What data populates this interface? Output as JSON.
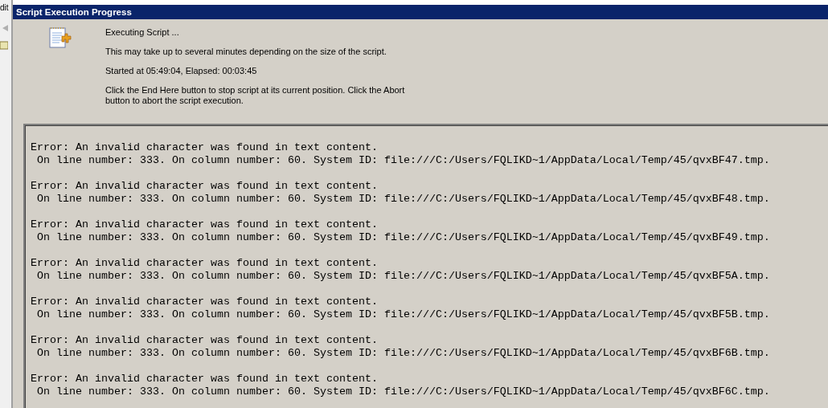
{
  "background_app": {
    "menu_text": "dit"
  },
  "dialog": {
    "title": "Script Execution Progress",
    "status": "Executing Script ...",
    "note": "This may take up to several minutes depending on the size of the script.",
    "timing": "Started at 05:49:04, Elapsed: 00:03:45",
    "instructions": "Click the End Here button to stop script at its current position. Click the Abort button to abort the script execution."
  },
  "log": [
    {
      "error": "Error: An invalid character was found in text content.",
      "detail": " On line number: 333. On column number: 60. System ID: file:///C:/Users/FQLIKD~1/AppData/Local/Temp/45/qvxBF47.tmp."
    },
    {
      "error": "Error: An invalid character was found in text content.",
      "detail": " On line number: 333. On column number: 60. System ID: file:///C:/Users/FQLIKD~1/AppData/Local/Temp/45/qvxBF48.tmp."
    },
    {
      "error": "Error: An invalid character was found in text content.",
      "detail": " On line number: 333. On column number: 60. System ID: file:///C:/Users/FQLIKD~1/AppData/Local/Temp/45/qvxBF49.tmp."
    },
    {
      "error": "Error: An invalid character was found in text content.",
      "detail": " On line number: 333. On column number: 60. System ID: file:///C:/Users/FQLIKD~1/AppData/Local/Temp/45/qvxBF5A.tmp."
    },
    {
      "error": "Error: An invalid character was found in text content.",
      "detail": " On line number: 333. On column number: 60. System ID: file:///C:/Users/FQLIKD~1/AppData/Local/Temp/45/qvxBF5B.tmp."
    },
    {
      "error": "Error: An invalid character was found in text content.",
      "detail": " On line number: 333. On column number: 60. System ID: file:///C:/Users/FQLIKD~1/AppData/Local/Temp/45/qvxBF6B.tmp."
    },
    {
      "error": "Error: An invalid character was found in text content.",
      "detail": " On line number: 333. On column number: 60. System ID: file:///C:/Users/FQLIKD~1/AppData/Local/Temp/45/qvxBF6C.tmp."
    }
  ]
}
